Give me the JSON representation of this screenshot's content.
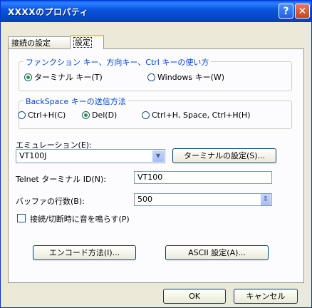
{
  "window": {
    "title": "XXXXのプロパティ",
    "help_glyph": "?",
    "close_glyph": "✕"
  },
  "tabs": [
    {
      "label": "接続の設定"
    },
    {
      "label": "設定"
    }
  ],
  "key_group": {
    "legend": "ファンクション キー、方向キー、Ctrl キーの使い方",
    "options": [
      {
        "label": "ターミナル キー(T)",
        "selected": true
      },
      {
        "label": "Windows キー(W)",
        "selected": false
      }
    ]
  },
  "backspace_group": {
    "legend": "BackSpace キーの送信方法",
    "options": [
      {
        "label": "Ctrl+H(C)",
        "selected": false
      },
      {
        "label": "Del(D)",
        "selected": true
      },
      {
        "label": "Ctrl+H, Space, Ctrl+H(H)",
        "selected": false
      }
    ]
  },
  "emulation": {
    "label": "エミュレーション(E):",
    "value": "VT100J",
    "arrow": "▼",
    "terminal_settings_button": "ターミナルの設定(S)..."
  },
  "telnet": {
    "label": "Telnet ターミナル ID(N):",
    "value": "VT100"
  },
  "buffer": {
    "label": "バッファの行数(B):",
    "value": "500",
    "spin": "⇕"
  },
  "sound_checkbox": {
    "label": "接続/切断時に音を鳴らす(P)",
    "checked": false
  },
  "buttons": {
    "encode": "エンコード方法(I)...",
    "ascii": "ASCII 設定(A)...",
    "ok": "OK",
    "cancel": "キャンセル"
  }
}
